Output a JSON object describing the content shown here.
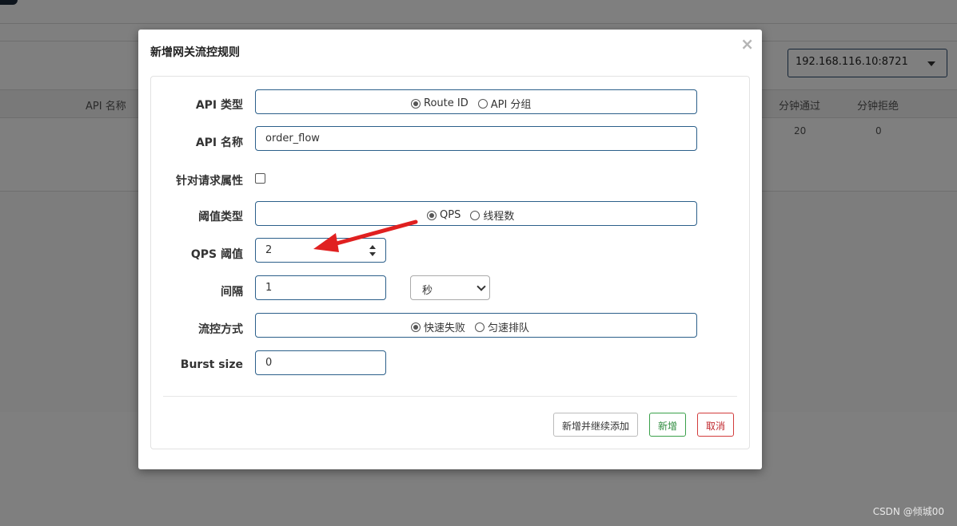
{
  "background": {
    "machine_select": "192.168.116.10:8721",
    "table_headers": [
      "API 名称",
      "分钟通过",
      "分钟拒绝"
    ],
    "table_row": {
      "pass": "20",
      "reject": "0"
    }
  },
  "watermark": "CSDN @倾城00",
  "modal": {
    "title": "新增网关流控规则",
    "close": "×",
    "fields": {
      "api_type": {
        "label": "API 类型",
        "options": [
          {
            "label": "Route ID",
            "checked": true
          },
          {
            "label": "API 分组",
            "checked": false
          }
        ]
      },
      "api_name": {
        "label": "API 名称",
        "value": "order_flow"
      },
      "request_attr": {
        "label": "针对请求属性",
        "checked": false
      },
      "threshold_type": {
        "label": "阈值类型",
        "options": [
          {
            "label": "QPS",
            "checked": true
          },
          {
            "label": "线程数",
            "checked": false
          }
        ]
      },
      "qps_threshold": {
        "label": "QPS 阈值",
        "value": "2"
      },
      "interval": {
        "label": "间隔",
        "value": "1",
        "unit": "秒"
      },
      "control_behavior": {
        "label": "流控方式",
        "options": [
          {
            "label": "快速失败",
            "checked": true
          },
          {
            "label": "匀速排队",
            "checked": false
          }
        ]
      },
      "burst_size": {
        "label": "Burst size",
        "value": "0"
      }
    },
    "buttons": {
      "add_continue": "新增并继续添加",
      "add": "新增",
      "cancel": "取消"
    }
  },
  "colors": {
    "field_border": "#2b5f8a",
    "success": "#3aa04a",
    "danger": "#d23b3b",
    "annotation_arrow": "#e02020"
  }
}
